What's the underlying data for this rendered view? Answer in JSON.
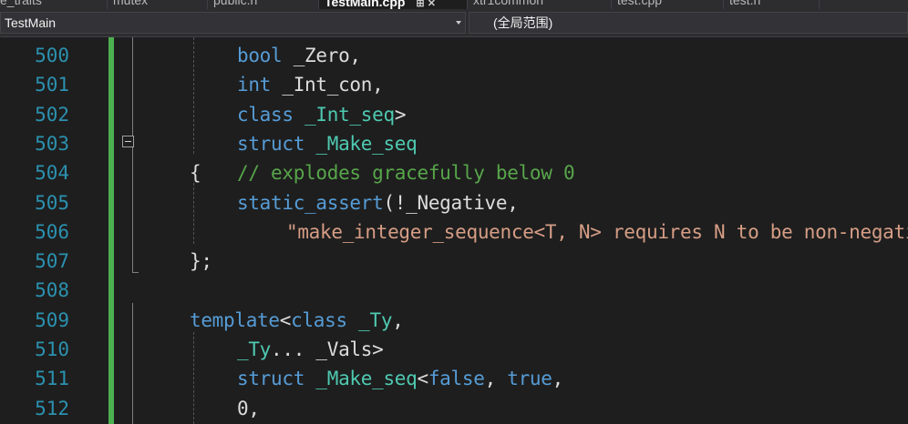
{
  "tabs": [
    {
      "label": "e_traits",
      "active": false
    },
    {
      "label": "mutex",
      "active": false
    },
    {
      "label": "public.h",
      "active": false
    },
    {
      "label": "TestMain.cpp",
      "active": true
    },
    {
      "label": "xtr1common",
      "active": false
    },
    {
      "label": "test.cpp",
      "active": false
    },
    {
      "label": "test.h",
      "active": false
    }
  ],
  "nav": {
    "project_scope": "TestMain",
    "global_scope": "(全局范围)"
  },
  "lines": [
    {
      "num": "500",
      "tokens": [
        {
          "t": "bool",
          "c": "kw"
        },
        {
          "t": " _Zero,",
          "c": ""
        }
      ]
    },
    {
      "num": "501",
      "tokens": [
        {
          "t": "int",
          "c": "kw"
        },
        {
          "t": " _Int_con,",
          "c": ""
        }
      ]
    },
    {
      "num": "502",
      "tokens": [
        {
          "t": "class",
          "c": "kw"
        },
        {
          "t": " ",
          "c": ""
        },
        {
          "t": "_Int_seq",
          "c": "tp"
        },
        {
          "t": ">",
          "c": ""
        }
      ]
    },
    {
      "num": "503",
      "tokens": [
        {
          "t": "struct",
          "c": "kw"
        },
        {
          "t": " ",
          "c": ""
        },
        {
          "t": "_Make_seq",
          "c": "tp"
        }
      ]
    },
    {
      "num": "504",
      "tokens": [
        {
          "t": "// explodes gracefully below 0",
          "c": "cm"
        }
      ]
    },
    {
      "num": "505",
      "tokens": [
        {
          "t": "static_assert",
          "c": "kw"
        },
        {
          "t": "(!_Negative,",
          "c": ""
        }
      ]
    },
    {
      "num": "506",
      "tokens": [
        {
          "t": "\"make_integer_sequence<T, N> requires N to be non-negative.\"",
          "c": "st"
        }
      ]
    },
    {
      "num": "507",
      "tokens": [
        {
          "t": "};",
          "c": ""
        }
      ]
    },
    {
      "num": "508",
      "tokens": []
    },
    {
      "num": "509",
      "tokens": [
        {
          "t": "template",
          "c": "kw"
        },
        {
          "t": "<",
          "c": ""
        },
        {
          "t": "class",
          "c": "kw"
        },
        {
          "t": " ",
          "c": ""
        },
        {
          "t": "_Ty",
          "c": "tp"
        },
        {
          "t": ",",
          "c": ""
        }
      ]
    },
    {
      "num": "510",
      "tokens": [
        {
          "t": "_Ty",
          "c": "tp"
        },
        {
          "t": "... _Vals>",
          "c": ""
        }
      ]
    },
    {
      "num": "511",
      "tokens": [
        {
          "t": "struct",
          "c": "kw"
        },
        {
          "t": " ",
          "c": ""
        },
        {
          "t": "_Make_seq",
          "c": "tp"
        },
        {
          "t": "<",
          "c": ""
        },
        {
          "t": "false",
          "c": "kw"
        },
        {
          "t": ", ",
          "c": ""
        },
        {
          "t": "true",
          "c": "kw"
        },
        {
          "t": ",",
          "c": ""
        }
      ]
    },
    {
      "num": "512",
      "tokens": [
        {
          "t": "0,",
          "c": ""
        }
      ]
    }
  ],
  "colors": {
    "keyword": "#569cd6",
    "type": "#4ec9b0",
    "comment": "#57a64a",
    "string": "#d69d85",
    "line_number": "#2b91af",
    "change_bar": "#4caf50"
  }
}
